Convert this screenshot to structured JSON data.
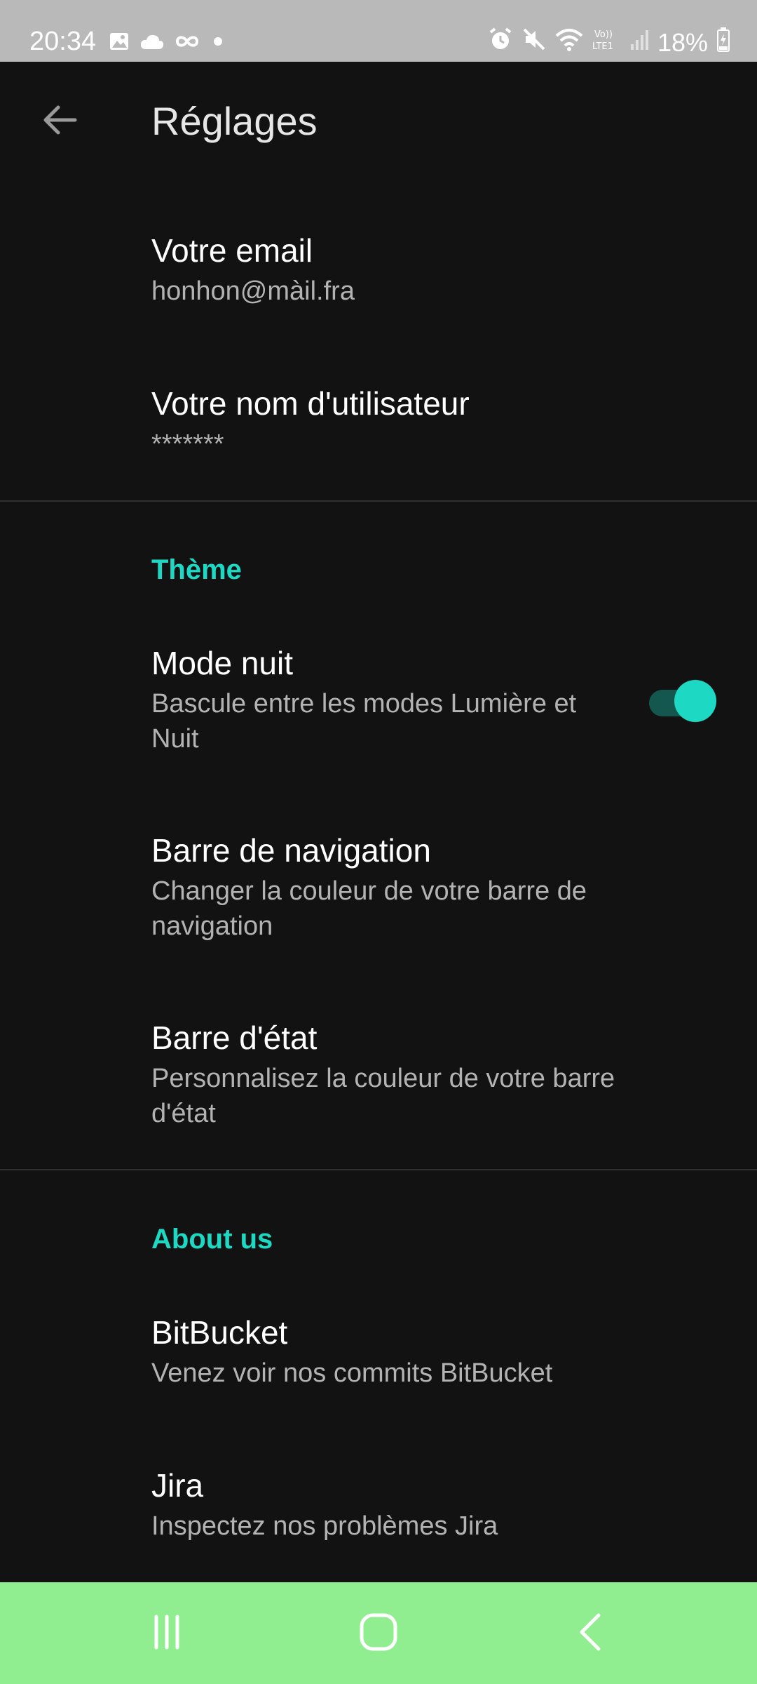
{
  "status_bar": {
    "time": "20:34",
    "battery": "18%",
    "left_icons": [
      "image-icon",
      "cloud-icon",
      "infinity-icon",
      "dot-icon"
    ],
    "right_icons": [
      "alarm-icon",
      "mute-icon",
      "wifi-icon",
      "volte-lte-icon",
      "signal-icon",
      "battery-icon"
    ]
  },
  "app_bar": {
    "title": "Réglages",
    "back_icon": "arrow-left-icon"
  },
  "account": {
    "email": {
      "title": "Votre email",
      "value": "honhon@màil.fra"
    },
    "username": {
      "title": "Votre nom d'utilisateur",
      "value": "*******"
    }
  },
  "theme": {
    "section_title": "Thème",
    "night_mode": {
      "title": "Mode nuit",
      "subtitle": "Bascule entre les modes Lumière et Nuit",
      "enabled": true
    },
    "navigation_bar": {
      "title": "Barre de navigation",
      "subtitle": "Changer la couleur de votre barre de navigation"
    },
    "status_bar": {
      "title": "Barre d'état",
      "subtitle": "Personnalisez la couleur de votre barre d'état"
    }
  },
  "about": {
    "section_title": "About us",
    "bitbucket": {
      "title": "BitBucket",
      "subtitle": "Venez voir nos commits BitBucket"
    },
    "jira": {
      "title": "Jira",
      "subtitle": "Inspectez nos problèmes Jira"
    }
  },
  "nav_bar": {
    "color": "#90ee90",
    "buttons": [
      "recents-icon",
      "home-icon",
      "back-icon"
    ]
  },
  "colors": {
    "background": "#121212",
    "accent": "#1dd9c4",
    "status_bar": "#b9b9b9"
  }
}
